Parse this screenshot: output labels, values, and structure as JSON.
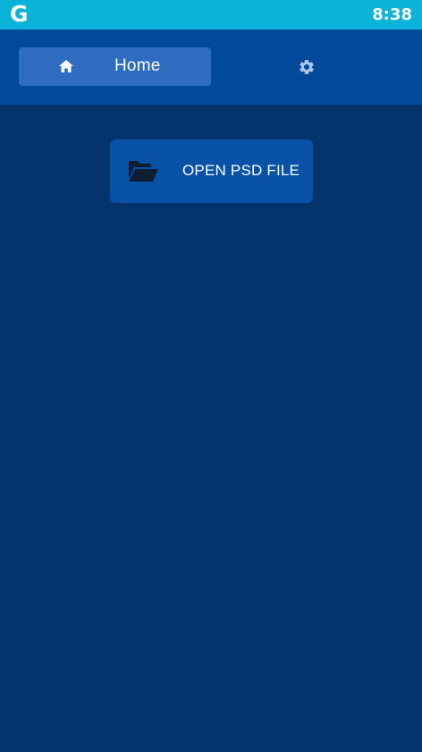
{
  "status_bar": {
    "logo_letter": "G",
    "time": "8:38",
    "background_color": "#0cb3d9"
  },
  "header": {
    "background_color": "#03499a",
    "tabs": [
      {
        "label": "Home",
        "icon": "home-icon",
        "active": true
      },
      {
        "label": "",
        "icon": "gear-icon",
        "active": false
      }
    ]
  },
  "main": {
    "background_color": "#03346b",
    "open_button": {
      "label": "OPEN PSD FILE",
      "icon": "folder-open-icon",
      "color": "#0751a7"
    }
  }
}
